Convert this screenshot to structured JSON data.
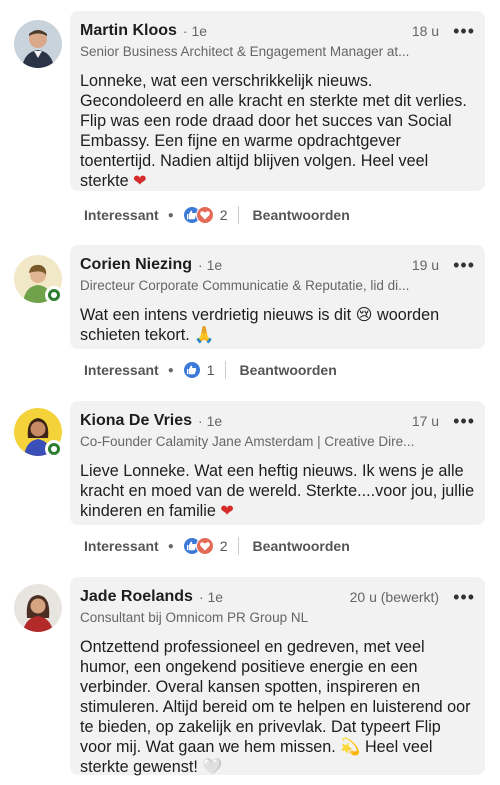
{
  "comments": [
    {
      "name": "Martin Kloos",
      "degree": "· 1e",
      "time": "18 u",
      "headline": "Senior Business Architect & Engagement Manager at...",
      "text": "Lonneke, wat een verschrikkelijk nieuws. Gecondoleerd en alle kracht en sterkte met dit verlies. Flip was een rode draad door het succes van Social Embassy. Een fijne en warme opdrachtgever toentertijd. Nadien altijd blijven volgen. Heel veel sterkte",
      "emoji": "❤",
      "reaction_label": "Interessant",
      "reaction_count": "2",
      "reply_label": "Beantwoorden",
      "reaction_icons": [
        "like-icon",
        "love-icon"
      ],
      "online": false
    },
    {
      "name": "Corien Niezing",
      "degree": "· 1e",
      "time": "19 u",
      "headline": "Directeur Corporate Communicatie & Reputatie, lid di...",
      "text": "Wat een intens verdrietig nieuws is dit",
      "text2": "woorden schieten tekort.",
      "emoji_mid": "😢",
      "emoji": "🙏",
      "reaction_label": "Interessant",
      "reaction_count": "1",
      "reply_label": "Beantwoorden",
      "reaction_icons": [
        "like-icon"
      ],
      "online": true
    },
    {
      "name": "Kiona De Vries",
      "degree": "· 1e",
      "time": "17 u",
      "headline": "Co-Founder Calamity Jane Amsterdam | Creative Dire...",
      "text": "Lieve Lonneke. Wat een heftig nieuws. Ik wens je alle kracht en moed van de wereld. Sterkte....voor jou, jullie kinderen en familie",
      "emoji": "❤",
      "reaction_label": "Interessant",
      "reaction_count": "2",
      "reply_label": "Beantwoorden",
      "reaction_icons": [
        "like-icon",
        "love-icon"
      ],
      "online": true
    },
    {
      "name": "Jade Roelands",
      "degree": "· 1e",
      "time": "20 u (bewerkt)",
      "headline": "Consultant bij Omnicom PR Group NL",
      "text": "Ontzettend professioneel en gedreven, met veel humor, een ongekend positieve energie en een verbinder. Overal kansen spotten, inspireren en stimuleren. Altijd bereid om te helpen en luisterend oor te bieden, op zakelijk en privevlak. Dat typeert Flip voor mij. Wat gaan we hem missen.",
      "emoji_mid": "💫",
      "text2": "Heel veel sterkte gewenst!",
      "emoji": "🤍",
      "online": false
    }
  ],
  "colors": {
    "bubble": "#f2f2f2",
    "like": "#3b7ad8",
    "love": "#e26a56",
    "online": "#2e7d32",
    "heart": "#d62b2b"
  }
}
